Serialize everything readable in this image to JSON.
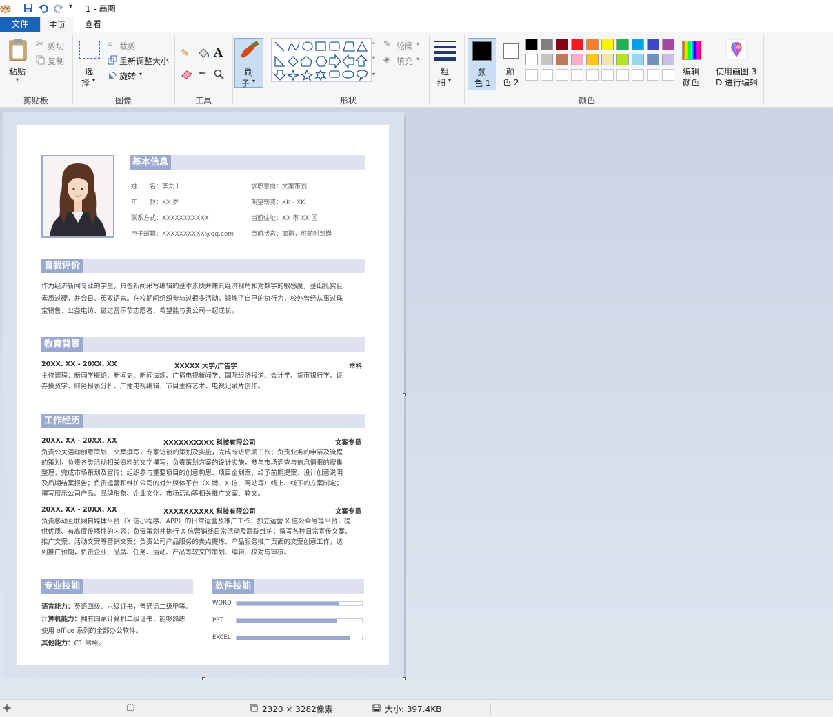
{
  "window": {
    "title": "1 - 画图"
  },
  "tabs": {
    "file": "文件",
    "home": "主页",
    "view": "查看"
  },
  "ribbon": {
    "clipboard": {
      "paste": "粘贴",
      "cut": "剪切",
      "copy": "复制",
      "label": "剪贴板"
    },
    "image": {
      "select1": "选",
      "select2": "择",
      "crop": "裁剪",
      "resize": "重新调整大小",
      "rotate": "旋转",
      "label": "图像"
    },
    "tools": {
      "label": "工具"
    },
    "brush": {
      "l1": "刷",
      "l2": "子"
    },
    "shapes": {
      "outline": "轮廓",
      "fill": "填充",
      "label": "形状"
    },
    "size": {
      "l1": "粗",
      "l2": "细"
    },
    "colors": {
      "color1_l1": "颜",
      "color1_l2": "色 1",
      "color2_l1": "颜",
      "color2_l2": "色 2",
      "edit_l1": "编辑",
      "edit_l2": "颜色",
      "label": "颜色",
      "color1": "#000000",
      "color2": "#ffffff",
      "palette_row1": [
        "#000000",
        "#7f7f7f",
        "#880015",
        "#ed1c24",
        "#ff7f27",
        "#fff200",
        "#22b14c",
        "#00a2e8",
        "#3f48cc",
        "#a349a4"
      ],
      "palette_row2": [
        "#ffffff",
        "#c3c3c3",
        "#b97a57",
        "#ffaec9",
        "#ffc90e",
        "#efe4b0",
        "#b5e61d",
        "#99d9ea",
        "#7092be",
        "#c8bfe7"
      ]
    },
    "paint3d": {
      "l1": "使用画图 3",
      "l2": "D 进行编辑"
    }
  },
  "resume": {
    "basic": {
      "title": "基本信息",
      "name": "姓　　名：李女士",
      "age": "年　　龄：XX 岁",
      "phone": "联系方式：XXXXXXXXXXX",
      "email": "电子邮箱：XXXXXXXXXX@qq.com",
      "intent": "求职意向：文案策划",
      "salary": "期望薪资：XK - XK",
      "addr": "当前住址：XX 市 XX 区",
      "status": "目前状态：离职，可随时到岗"
    },
    "self": {
      "title": "自我评价",
      "l1": "作为经济新闻专业的学生，具备新闻采写编辑的基本素质并兼具经济视角和对数字的敏感度，基础扎实且",
      "l2": "素质过硬，并会日、英双语言。在校期间组织参与过很多活动，锻炼了自己的执行力，校外曾经从事过珠",
      "l3": "宝销售、公益电访、做过音乐节志愿者，希望能与贵公司一起成长。"
    },
    "edu": {
      "title": "教育背景",
      "date": "20XX. XX - 20XX. XX",
      "school": "XXXXX 大学/广告学",
      "degree": "本科",
      "l1": "主修课程：新闻学概论、新闻史、新闻法规、广播电视新闻学、国际经济报道、会计学、货币银行学、证",
      "l2": "券投资学、财务报表分析、广播电视编辑、节目主持艺术、电视记录片创作。"
    },
    "work": {
      "title": "工作经历",
      "j1_date": "20XX. XX - 20XX. XX",
      "j1_company": "XXXXXXXXXX 科技有限公司",
      "j1_role": "文案专员",
      "j1_l1": "负责公关活动创意策划、文案撰写，专家访谈的策划及实施，完成专访后期工作；负责业务的申请及流程",
      "j1_l2": "的策划，负责各类活动相关资料的文字撰写；负责策划方案的设计实施，参与市场调查与信息情报的搜集",
      "j1_l3": "整理，完成市场策划及宣传；组织参与重要项目的创意构思、项目企划案，给予前期提案、设计创意说明",
      "j1_l4": "及后期结案报告；负责运营和维护公司的对外媒体平台（X 博、X 信、网站等）线上、线下的方案制定；",
      "j1_l5": "撰写展示公司产品、品牌形象、企业文化、市场活动等相关推广文案、软文。",
      "j2_date": "20XX. XX - 20XX. XX",
      "j2_company": "XXXXXXXXXX 科技有限公司",
      "j2_role": "文案专员",
      "j2_l1": "负责移动互联网自媒体平台（X 信小程序、APP）的日常运营及推广工作；独立运营 X 信公众号等平台，提",
      "j2_l2": "供优质、有高度传播性的内容；负责策划并执行 X 信营销线日常活动及跟踪维护；撰写各种日常宣传文案、",
      "j2_l3": "推广文案、活动文案等营销文案；负责公司产品服务的卖点提炼、产品服务推广页面的文案创意工作，达",
      "j2_l4": "到推广预期，负责企业、品牌、任务、活动、产品等软文的策划、编辑、校对与审核。"
    },
    "skills": {
      "title": "专业技能",
      "lang_k": "语言能力：",
      "lang_v": "英语四级、六级证书，普通话二级甲等。",
      "comp_k": "计算机能力：",
      "comp_v": "拥有国家计算机二级证书，能够熟练",
      "comp_v2": "使用 office 系列的全部办公软件。",
      "other_k": "其他能力：",
      "other_v": "C1 驾照。"
    },
    "software": {
      "title": "软件技能",
      "items": [
        {
          "name": "WORD",
          "level": 0.82
        },
        {
          "name": "PPT",
          "level": 0.8
        },
        {
          "name": "EXCEL",
          "level": 0.9
        }
      ]
    }
  },
  "status": {
    "dimensions": "2320 × 3282像素",
    "size": "大小: 397.4KB"
  }
}
